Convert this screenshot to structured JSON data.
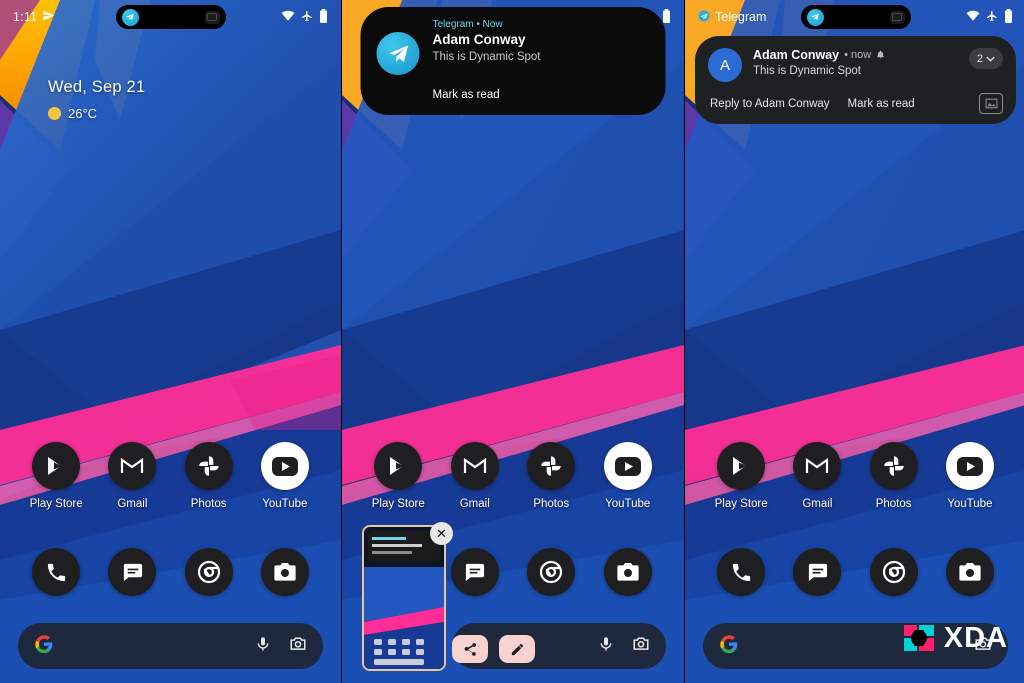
{
  "phones": [
    {
      "id": "phone-1",
      "statusbar": {
        "time": "1:11",
        "icons": [
          "telegram-send-icon",
          "wifi-icon",
          "airplane-icon",
          "battery-icon"
        ]
      },
      "pill": {
        "type": "dynamic-spot-collapsed",
        "app_icon": "telegram-icon",
        "camera_icon": "camera-cutout-icon"
      },
      "clock_widget": {
        "date": "Wed, Sep 21",
        "temperature": "26°C",
        "weather_icon": "sunny-icon"
      }
    },
    {
      "id": "phone-2",
      "statusbar": {
        "time": "",
        "icons": [
          "wifi-icon",
          "airplane-icon",
          "battery-icon"
        ]
      },
      "notification_island": {
        "header": "Telegram • Now",
        "sender": "Adam Conway",
        "message": "This is Dynamic Spot",
        "action": "Mark as read",
        "avatar_icon": "telegram-icon"
      },
      "screenshot_preview": {
        "close_label": "✕",
        "share_icon": "share-icon",
        "edit_icon": "pencil-icon"
      }
    },
    {
      "id": "phone-3",
      "statusbar": {
        "app_name": "Telegram",
        "icons": [
          "wifi-icon",
          "airplane-icon",
          "battery-icon"
        ]
      },
      "pill": {
        "type": "dynamic-spot-collapsed",
        "app_icon": "telegram-icon",
        "camera_icon": "camera-cutout-icon"
      },
      "expanded_notification": {
        "avatar_letter": "A",
        "sender": "Adam Conway",
        "meta": "• now",
        "message": "This is Dynamic Spot",
        "count": "2",
        "chevron_icon": "chevron-down-icon",
        "actions": [
          "Reply to Adam Conway",
          "Mark as read"
        ],
        "image_icon": "image-attachment-icon"
      }
    }
  ],
  "apps_row1": [
    {
      "label": "Play Store",
      "icon": "play-store-icon"
    },
    {
      "label": "Gmail",
      "icon": "gmail-icon"
    },
    {
      "label": "Photos",
      "icon": "google-photos-icon"
    },
    {
      "label": "YouTube",
      "icon": "youtube-icon"
    }
  ],
  "apps_row2": [
    {
      "label": "",
      "icon": "phone-icon"
    },
    {
      "label": "",
      "icon": "messages-icon"
    },
    {
      "label": "",
      "icon": "chrome-icon"
    },
    {
      "label": "",
      "icon": "camera-icon"
    }
  ],
  "search_bar": {
    "google_icon": "google-g-icon",
    "mic_icon": "microphone-icon",
    "lens_icon": "google-lens-icon"
  },
  "watermark": {
    "text": "XDA",
    "mark": "xda-logo-icon"
  },
  "colors": {
    "telegram": "#29a9e1",
    "accent_pink": "#f9197f",
    "wallpaper_blue": "#1b3a8c",
    "wallpaper_orange": "#f5a623",
    "island_bg": "#0b0b0b",
    "notif_bg": "#1e2022"
  }
}
